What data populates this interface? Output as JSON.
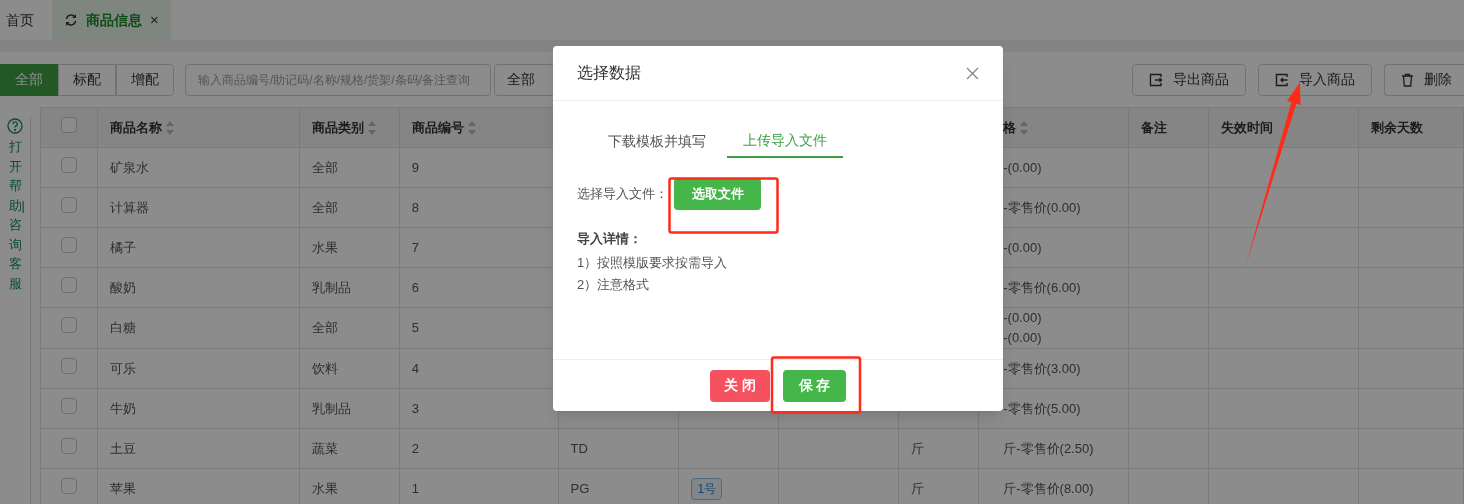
{
  "tabs": [
    {
      "label": "首页",
      "selected": false
    },
    {
      "label": "商品信息",
      "selected": true,
      "close_glyph": "×"
    }
  ],
  "filter_buttons": [
    {
      "label": "全部",
      "selected": true
    },
    {
      "label": "标配",
      "selected": false
    },
    {
      "label": "增配",
      "selected": false
    }
  ],
  "search": {
    "placeholder": "输入商品编号/助记码/名称/规格/货架/条码/备注查询"
  },
  "category_select": {
    "value": "全部"
  },
  "actions": [
    {
      "label": "导出商品",
      "kind": "export"
    },
    {
      "label": "导入商品",
      "kind": "import"
    },
    {
      "label": "删除",
      "kind": "delete"
    }
  ],
  "help": {
    "text": "打开帮助|咨询客服"
  },
  "table": {
    "header_checked": false,
    "columns": [
      {
        "label": "商品名称",
        "sortable": true
      },
      {
        "label": "商品类别",
        "sortable": true
      },
      {
        "label": "商品编号",
        "sortable": true
      },
      {},
      {},
      {},
      {},
      {
        "label": "格",
        "sortable": true
      },
      {
        "label": "备注",
        "sortable": false
      },
      {
        "label": "失效时间",
        "sortable": false
      },
      {
        "label": "剩余天数",
        "sortable": false
      }
    ],
    "rows": [
      {
        "checked": false,
        "name": "矿泉水",
        "category": "全部",
        "code": "9",
        "price": [
          "-(0.00)"
        ]
      },
      {
        "checked": false,
        "name": "计算器",
        "category": "全部",
        "code": "8",
        "price": [
          "-零售价(0.00)"
        ]
      },
      {
        "checked": false,
        "name": "橘子",
        "category": "水果",
        "code": "7",
        "price": [
          "-(0.00)"
        ]
      },
      {
        "checked": false,
        "name": "酸奶",
        "category": "乳制品",
        "code": "6",
        "price": [
          "-零售价(6.00)"
        ]
      },
      {
        "checked": false,
        "name": "白糖",
        "category": "全部",
        "code": "5",
        "price": [
          "-(0.00)",
          "-(0.00)"
        ]
      },
      {
        "checked": false,
        "name": "可乐",
        "category": "饮料",
        "code": "4",
        "price": [
          "-零售价(3.00)"
        ]
      },
      {
        "checked": false,
        "name": "牛奶",
        "category": "乳制品",
        "code": "3",
        "price": [
          "-零售价(5.00)"
        ]
      },
      {
        "checked": false,
        "name": "土豆",
        "category": "蔬菜",
        "code": "2",
        "column_5": "TD",
        "unit": "斤",
        "price": [
          "斤-零售价(2.50)"
        ]
      },
      {
        "checked": false,
        "name": "苹果",
        "category": "水果",
        "code": "1",
        "column_5": "PG",
        "tag": "1号",
        "unit": "斤",
        "price": [
          "斤-零售价(8.00)"
        ]
      }
    ]
  },
  "dialog": {
    "title": "选择数据",
    "tabs": [
      {
        "label": "下载模板并填写",
        "selected": false
      },
      {
        "label": "上传导入文件",
        "selected": true
      }
    ],
    "file_label": "选择导入文件：",
    "file_button": "选取文件",
    "details_title": "导入详情：",
    "details": [
      "1）按照模版要求按需导入",
      "2）注意格式"
    ],
    "buttons": [
      {
        "label": "关 闭",
        "kind": "close"
      },
      {
        "label": "保 存",
        "kind": "save"
      }
    ]
  }
}
